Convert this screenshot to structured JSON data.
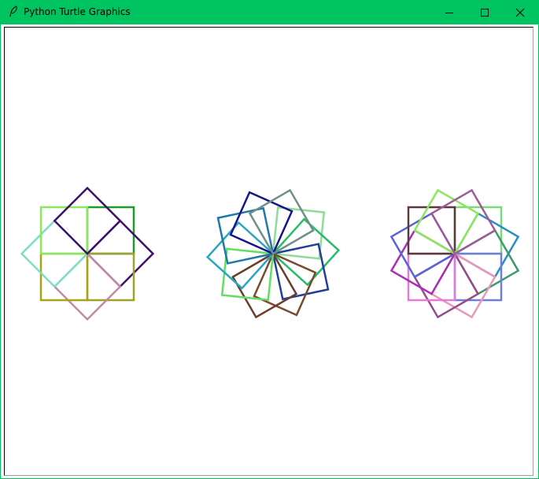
{
  "window": {
    "title": "Python Turtle Graphics",
    "accent_color": "#00c45f",
    "icons": {
      "app": "feather-icon",
      "minimize": "minimize-icon",
      "maximize": "maximize-icon",
      "close": "close-icon"
    }
  },
  "drawing": {
    "background": "#ffffff",
    "figures": [
      {
        "name": "four-square-rosette",
        "squares": 8,
        "colors": [
          "#1e9a2f",
          "#3d116b",
          "#a0a02c",
          "#c28aa6",
          "#a7a517",
          "#7fdcc7",
          "#8ae85e",
          "#3d116b"
        ]
      },
      {
        "name": "ten-square-rosette",
        "squares": 10,
        "colors": [
          "#8fdc98",
          "#25bd6a",
          "#1f3f9a",
          "#7b4a2d",
          "#6a3e2a",
          "#5fe05f",
          "#2aa6c0",
          "#1e77ae",
          "#17158c",
          "#6f8f87"
        ]
      },
      {
        "name": "twelve-square-rosette",
        "squares": 12,
        "colors": [
          "#79d97c",
          "#2a8cc8",
          "#3e9a6a",
          "#6f7fd8",
          "#e898b8",
          "#9a4a8a",
          "#e27ad8",
          "#a92db5",
          "#5a64d8",
          "#5a3a3a",
          "#8ae85e",
          "#a05a9a"
        ]
      }
    ]
  }
}
